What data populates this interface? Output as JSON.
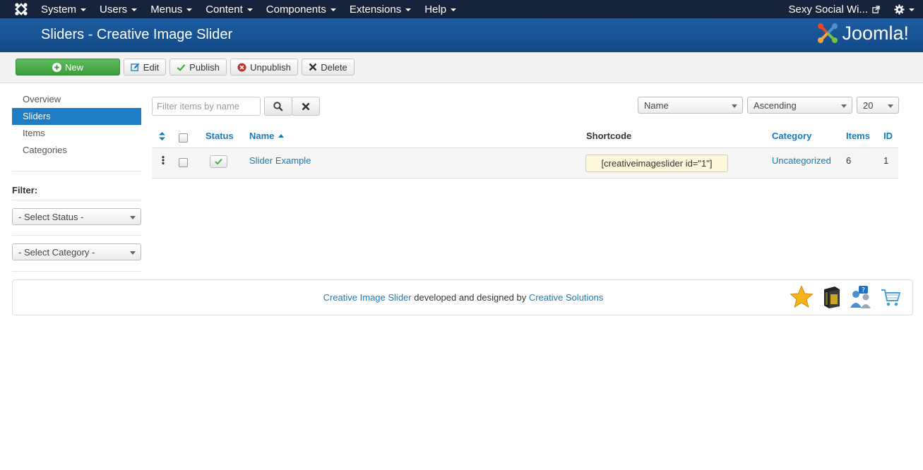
{
  "topnav": {
    "menu": [
      "System",
      "Users",
      "Menus",
      "Content",
      "Components",
      "Extensions",
      "Help"
    ],
    "site_link": "Sexy Social Wi..."
  },
  "header": {
    "title": "Sliders - Creative Image Slider",
    "brand": "Joomla!"
  },
  "toolbar": {
    "new_label": "New",
    "edit_label": "Edit",
    "publish_label": "Publish",
    "unpublish_label": "Unpublish",
    "delete_label": "Delete"
  },
  "sidebar": {
    "items": [
      "Overview",
      "Sliders",
      "Items",
      "Categories"
    ],
    "active": "Sliders",
    "filter_label": "Filter:",
    "status_select": "- Select Status -",
    "category_select": "- Select Category -"
  },
  "search": {
    "placeholder": "Filter items by name"
  },
  "sort": {
    "field": "Name",
    "direction": "Ascending",
    "limit": "20"
  },
  "table": {
    "headers": {
      "status": "Status",
      "name": "Name",
      "shortcode": "Shortcode",
      "category": "Category",
      "items": "Items",
      "id": "ID"
    },
    "rows": [
      {
        "name": "Slider Example",
        "shortcode": "[creativeimageslider id=\"1\"]",
        "category": "Uncategorized",
        "items": "6",
        "id": "1"
      }
    ]
  },
  "footer": {
    "product_link": "Creative Image Slider",
    "middle_text": "developed and designed by",
    "company_link": "Creative Solutions"
  },
  "colors": {
    "topnav_bg": "#17233b",
    "header_bg": "#1d5da1",
    "active_item": "#1d7cc4",
    "link": "#1a7ab8",
    "new_button": "#46a546"
  }
}
